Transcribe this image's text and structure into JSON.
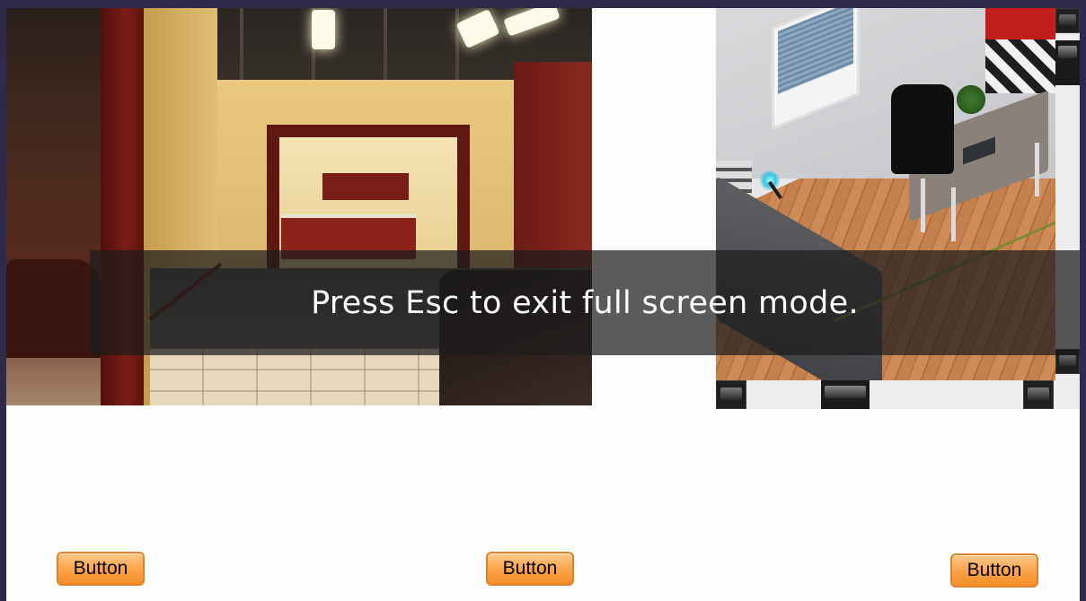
{
  "overlay": {
    "message": "Press Esc to exit full screen mode."
  },
  "scrollbars": {
    "up_icon": "arrow-up",
    "down_icon": "arrow-down",
    "left_icon": "arrow-left",
    "right_icon": "arrow-right"
  },
  "buttons": [
    {
      "label": "Button"
    },
    {
      "label": "Button"
    },
    {
      "label": "Button"
    }
  ],
  "colors": {
    "frame": "#2e2b4a",
    "button_orange": "#fca248",
    "banner": "#1c1c1c"
  }
}
